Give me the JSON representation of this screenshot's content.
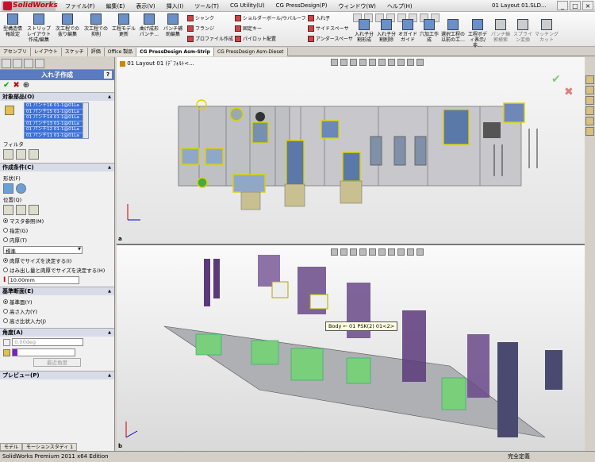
{
  "app": {
    "name": "SolidWorks",
    "doc_title": "01 Layout 01.SLD..."
  },
  "menus": [
    "ファイル(F)",
    "編集(E)",
    "表示(V)",
    "挿入(I)",
    "ツール(T)",
    "CG Utility(U)",
    "CG PressDesign(P)",
    "ウィンドウ(W)",
    "ヘルプ(H)"
  ],
  "ribbon": {
    "big": [
      {
        "label": "型構造情報設定"
      },
      {
        "label": "ストリップレイアウト作成/編集"
      },
      {
        "label": "次工程での抜り編集"
      },
      {
        "label": "次工程での抑削"
      },
      {
        "label": "工程モデル更新"
      },
      {
        "label": "曲げ成形パンチ…"
      },
      {
        "label": "パンチ補助編集"
      }
    ],
    "small": [
      "シャンク",
      "フランジ",
      "プロファイル作成",
      "ショルダーボール/ウバルーフ",
      "固定キー",
      "パイロット配置",
      "入れ子",
      "サイドスペーサ",
      "アンダースペーサ"
    ],
    "big2": [
      {
        "label": "入れ子分割形成"
      },
      {
        "label": "入れ子分割削除"
      },
      {
        "label": "オガイドガイド"
      },
      {
        "label": "穴加工作成"
      },
      {
        "label": "選択工程の以前の工…"
      },
      {
        "label": "工程ボディ表示/非…"
      },
      {
        "label": "パンチ輪郭検索"
      },
      {
        "label": "スプライン変換"
      },
      {
        "label": "マッチングカット"
      }
    ]
  },
  "tabs": [
    "アセンブリ",
    "レイアウト",
    "スケッチ",
    "評価",
    "Office 製品",
    "CG PressDesign Asm-Strip",
    "CG PressDesign Asm-Dieset"
  ],
  "active_tab": 5,
  "pm": {
    "title": "入れ子作成",
    "help": "?",
    "ok": "✔",
    "cancel": "✖",
    "pushpin": "⊕",
    "target_header": "対象部品(O)",
    "target_items": [
      "01 パンチ16 01-1@01La",
      "01 パンチ15 01-1@01La",
      "01 パンチ14 01-1@01La",
      "01 パンチ13 01-1@01La",
      "01 パンチ12 01-1@01La",
      "01 パンチ11 01-1@01La"
    ],
    "filter_label": "フィルタ",
    "cond_header": "作成条件(C)",
    "shape_label": "形状(F)",
    "pos_label": "位置(Q)",
    "pos_options": [
      "マスタ参照(M)",
      "指定(G)",
      "内厚(T)"
    ],
    "std_value": "標準",
    "size_options": [
      "肉厚でサイズを決定する(I)",
      "はみ出し量と肉厚でサイズを決定する(H)"
    ],
    "thickness": "10.00mm",
    "ref_header": "基準断面(E)",
    "ref_options": [
      "基準面(Y)",
      "高さ入力(Y)",
      "高さ比状入力(J)"
    ],
    "angle_header": "角度(A)",
    "angle_value": "0.00deg",
    "recent_angle": "最近角度",
    "preview_header": "プレビュー(P)"
  },
  "viewport": {
    "breadcrumb": "01 Layout 01  (ﾃﾞﾌｫﾙﾄ<...",
    "top_label": "a",
    "bottom_label": "b",
    "tooltip": "Body ← 01 PSK(2) 01<2>"
  },
  "bottom_tabs": [
    "モデル",
    "モーションスタディ 1"
  ],
  "status": {
    "left": "SolidWorks Premium 2011 x64 Edition",
    "right": "完全定義"
  }
}
